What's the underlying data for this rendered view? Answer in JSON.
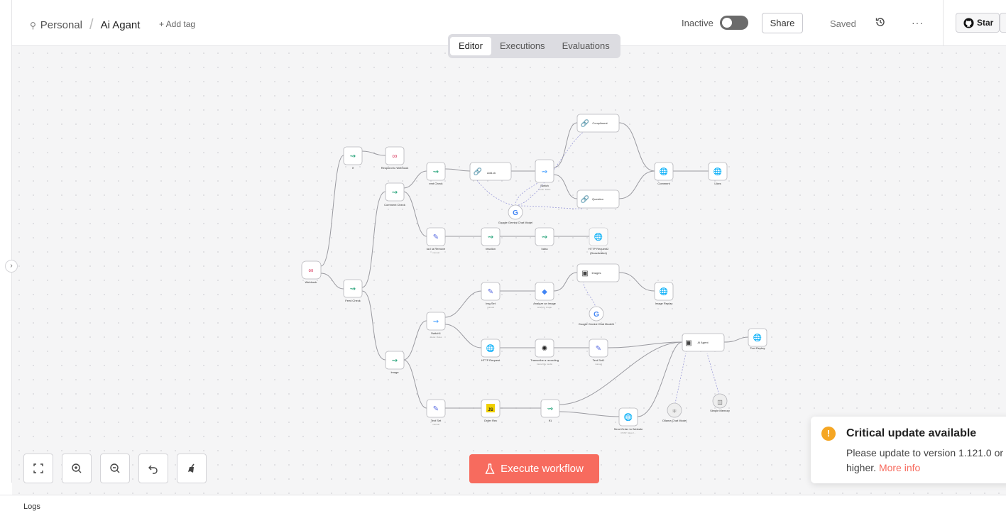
{
  "header": {
    "project": "Personal",
    "workflow_name": "Ai Agant",
    "add_tag": "+ Add tag",
    "status_label": "Inactive",
    "share_label": "Share",
    "saved_label": "Saved",
    "more_label": "···",
    "star_label": "Star"
  },
  "tabs": [
    "Editor",
    "Executions",
    "Evaluations"
  ],
  "workflow": {
    "nodes": [
      {
        "label": "Webhook"
      },
      {
        "label": "If"
      },
      {
        "label": "Respond to Webhook"
      },
      {
        "label": "Feed Check"
      },
      {
        "label": "Comment Check"
      },
      {
        "label": "emt Check"
      },
      {
        "label": "Add.ck"
      },
      {
        "label": "Switch",
        "sub": "mode: Rules"
      },
      {
        "label": "Compliment"
      },
      {
        "label": "Question"
      },
      {
        "label": "Comment"
      },
      {
        "label": "Likes"
      },
      {
        "label": "Google Gemini Chat Model"
      },
      {
        "label": "ka l ia Remove",
        "sub": "manual"
      },
      {
        "label": "reaction"
      },
      {
        "label": "haha"
      },
      {
        "label": "HTTP Request2",
        "sub": "(Deactivated)"
      },
      {
        "label": "Image"
      },
      {
        "label": "Switch1",
        "sub": "mode: Rules"
      },
      {
        "label": "Img Set",
        "sub": "manual"
      },
      {
        "label": "Analyze an image",
        "sub": "analyze: image"
      },
      {
        "label": "Images"
      },
      {
        "label": "Google Gemini Chat Model1"
      },
      {
        "label": "Image Replay"
      },
      {
        "label": "HTTP Request"
      },
      {
        "label": "Transcribe a recording",
        "sub": "transcribe: audio"
      },
      {
        "label": "Text Set1",
        "sub": "manual"
      },
      {
        "label": "AI Agent"
      },
      {
        "label": "Text Replay"
      },
      {
        "label": "Text Set",
        "sub": "manual"
      },
      {
        "label": "Order Rec"
      },
      {
        "label": "If1"
      },
      {
        "label": "Send Order to Website",
        "sub": "POST: https://..."
      },
      {
        "label": "Ollama Chat Model"
      },
      {
        "label": "Simple Memory"
      }
    ]
  },
  "controls": {
    "fit_view": "fit-view",
    "zoom_in": "zoom-in",
    "zoom_out": "zoom-out",
    "undo": "undo",
    "tidy": "tidy-up"
  },
  "execute_label": "Execute workflow",
  "toast": {
    "title": "Critical update available",
    "message": "Please update to version 1.121.0 or higher.",
    "link": "More info"
  },
  "logs_label": "Logs",
  "colors": {
    "accent": "#f76b5e",
    "warning": "#f5a623",
    "if_node": "#2aa57c",
    "switch_node": "#4da3ff",
    "http_node": "#5568e0"
  }
}
